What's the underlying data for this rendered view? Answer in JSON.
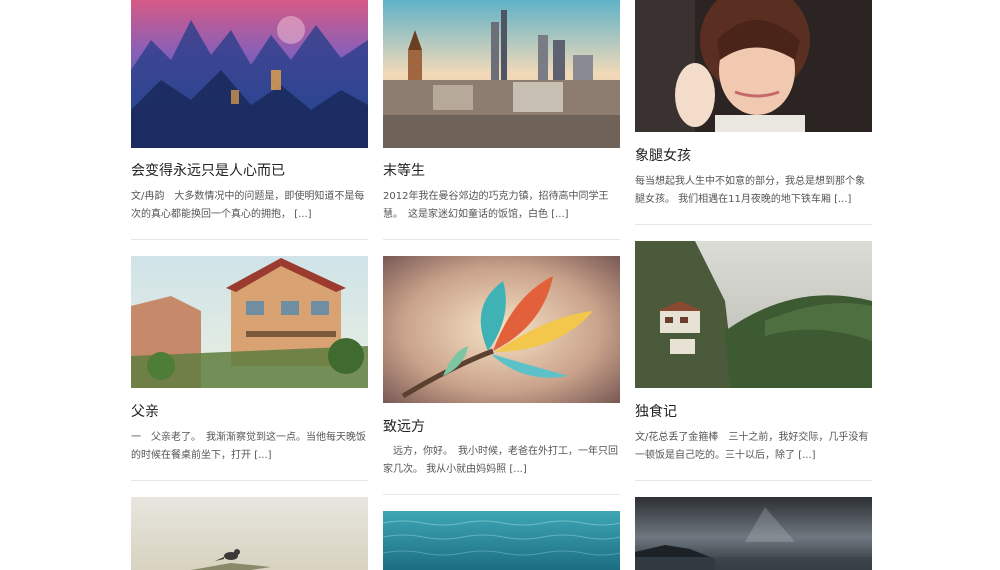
{
  "posts": [
    {
      "title": "会变得永远只是人心而已",
      "excerpt": "文/冉韵　大多数情况中的问题是，即使明知道不是每次的真心都能换回一个真心的拥抱，",
      "more": "[...]",
      "image": "fantasy-landscape"
    },
    {
      "title": "末等生",
      "excerpt": "2012年我在曼谷郊边的巧克力镇，招待高中同学王慧。　这是家迷幻如童话的饭馆，白色",
      "more": "[...]",
      "image": "city-skyline"
    },
    {
      "title": "象腿女孩",
      "excerpt": "每当想起我人生中不如意的部分，我总是想到那个象腿女孩。 我们相遇在11月夜晚的地下铁车厢",
      "more": "[...]",
      "image": "girl-portrait"
    },
    {
      "title": "父亲",
      "excerpt": "一　父亲老了。　我渐渐察觉到这一点。当他每天晚饭的时候在餐桌前坐下，打开",
      "more": "[...]",
      "image": "anime-house"
    },
    {
      "title": "致远方",
      "excerpt": "　远方，你好。　我小时候，老爸在外打工，一年只回家几次。 我从小就由妈妈照",
      "more": "[...]",
      "image": "colorful-leaves"
    },
    {
      "title": "独食记",
      "excerpt": "文/花总丢了金箍棒　三十之前，我好交际，几乎没有一顿饭是自己吃的。三十以后，除了",
      "more": "[...]",
      "image": "mountain-monastery"
    },
    {
      "image": "bird-on-branch"
    },
    {
      "image": "ocean-water"
    },
    {
      "image": "stormy-coast"
    }
  ]
}
